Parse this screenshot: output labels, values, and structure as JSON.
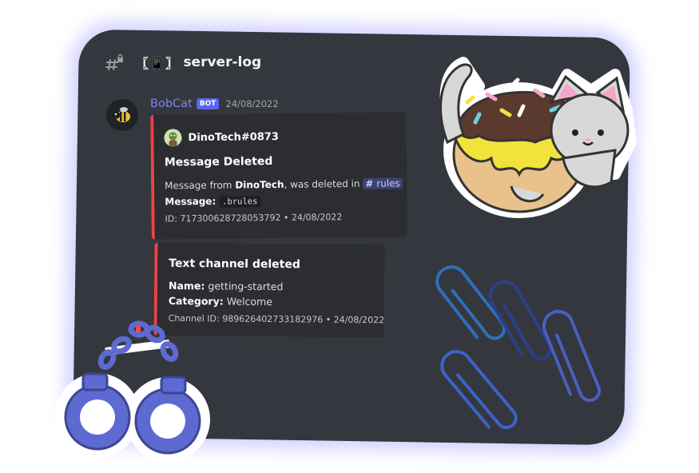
{
  "channel": {
    "prefix": "〖📱〗",
    "name": "server-log",
    "icon": "hash-lock-icon"
  },
  "message": {
    "username": "BobCat",
    "bot_tag": "BOT",
    "timestamp": "24/08/2022"
  },
  "embeds": [
    {
      "author": "DinoTech#0873",
      "title": "Message Deleted",
      "desc_prefix": "Message from ",
      "desc_user": "DinoTech",
      "desc_mid": ", was deleted in ",
      "channel_mention": "rules",
      "message_label": "Message:",
      "message_code": ".brules",
      "footer": "ID: 717300628728053792 • 24/08/2022",
      "accent": "#ed4245"
    },
    {
      "title": "Text channel deleted",
      "name_label": "Name:",
      "name_value": "getting-started",
      "category_label": "Category:",
      "category_value": "Welcome",
      "footer": "Channel ID: 989626402733182976 • 24/08/2022",
      "accent": "#ed4245"
    }
  ],
  "colors": {
    "panel": "#34373d",
    "username": "#7b83f4",
    "glow": "#7e78ff"
  }
}
